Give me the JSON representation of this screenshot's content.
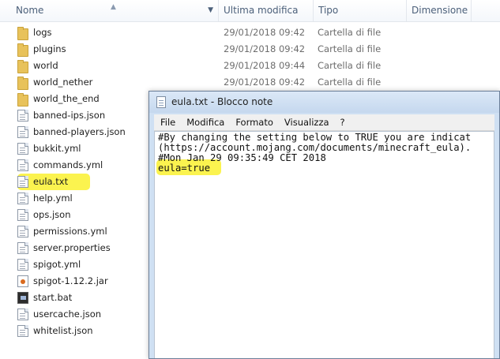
{
  "explorer": {
    "columns": {
      "name": "Nome",
      "date": "Ultima modifica",
      "type": "Tipo",
      "size": "Dimensione"
    },
    "rows": [
      {
        "name": "logs",
        "date": "29/01/2018 09:42",
        "type": "Cartella di file",
        "icon": "folder-icon"
      },
      {
        "name": "plugins",
        "date": "29/01/2018 09:42",
        "type": "Cartella di file",
        "icon": "folder-icon"
      },
      {
        "name": "world",
        "date": "29/01/2018 09:44",
        "type": "Cartella di file",
        "icon": "folder-icon"
      },
      {
        "name": "world_nether",
        "date": "29/01/2018 09:42",
        "type": "Cartella di file",
        "icon": "folder-icon"
      },
      {
        "name": "world_the_end",
        "date": "",
        "type": "",
        "icon": "folder-icon"
      },
      {
        "name": "banned-ips.json",
        "icon": "file-icon"
      },
      {
        "name": "banned-players.json",
        "icon": "file-icon"
      },
      {
        "name": "bukkit.yml",
        "icon": "file-icon"
      },
      {
        "name": "commands.yml",
        "icon": "file-icon"
      },
      {
        "name": "eula.txt",
        "icon": "text-file-icon",
        "highlighted": true
      },
      {
        "name": "help.yml",
        "icon": "file-icon"
      },
      {
        "name": "ops.json",
        "icon": "file-icon"
      },
      {
        "name": "permissions.yml",
        "icon": "file-icon"
      },
      {
        "name": "server.properties",
        "icon": "file-icon"
      },
      {
        "name": "spigot.yml",
        "icon": "file-icon"
      },
      {
        "name": "spigot-1.12.2.jar",
        "icon": "jar-icon"
      },
      {
        "name": "start.bat",
        "icon": "batch-icon"
      },
      {
        "name": "usercache.json",
        "icon": "file-icon"
      },
      {
        "name": "whitelist.json",
        "icon": "file-icon"
      }
    ]
  },
  "notepad": {
    "title": "eula.txt - Blocco note",
    "menu": [
      "File",
      "Modifica",
      "Formato",
      "Visualizza",
      "?"
    ],
    "lines": [
      "#By changing the setting below to TRUE you are indicat",
      "(https://account.mojang.com/documents/minecraft_eula).",
      "#Mon Jan 29 09:35:49 CET 2018",
      "eula=true"
    ],
    "highlight_color": "#fbf34f"
  }
}
